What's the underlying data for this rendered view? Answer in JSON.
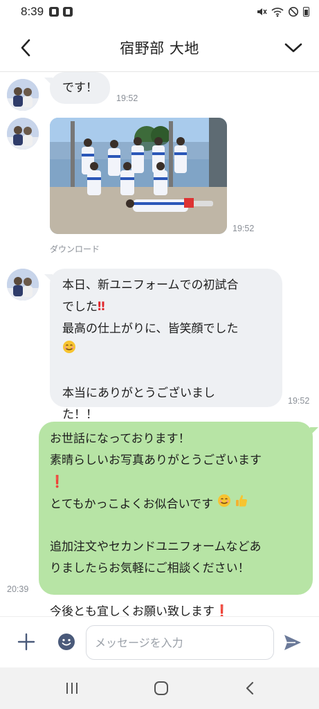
{
  "status_bar": {
    "time": "8:39",
    "left_icons": [
      "line-notification-icon",
      "app-notification-icon"
    ],
    "right_icons": [
      "mute-icon",
      "wifi-icon",
      "dnd-icon",
      "battery-icon"
    ]
  },
  "header": {
    "title": "宿野部 大地",
    "back_icon": "chevron-left-icon",
    "menu_icon": "chevron-down-icon"
  },
  "messages": [
    {
      "direction": "in",
      "type": "text",
      "lines": [
        "です！"
      ],
      "time": "19:52"
    },
    {
      "direction": "in",
      "type": "image",
      "time": "19:52",
      "download_label": "ダウンロード"
    },
    {
      "direction": "in",
      "type": "text",
      "lines": [
        "本日、新ユニフォームでの初試合",
        "でした",
        "最高の仕上がりに、皆笑顔でした",
        "",
        "",
        "本当にありがとうございまし",
        "た！！"
      ],
      "time": "19:52"
    },
    {
      "direction": "out",
      "type": "text",
      "lines": [
        "お世話になっております！",
        "素晴らしいお写真ありがとうございます",
        "",
        "とてもかっこよくお似合いです",
        "",
        "追加注文やセカンドユニフォームなどあ",
        "りましたらお気軽にご相談ください！",
        "",
        "今後とも宜しくお願い致します"
      ],
      "time": "20:39"
    }
  ],
  "input_bar": {
    "placeholder": "メッセージを入力",
    "value": ""
  },
  "colors": {
    "incoming_bubble": "#eef0f3",
    "outgoing_bubble": "#b7e4a5",
    "timestamp": "#8a8f97",
    "accent": "#4a5a7a"
  }
}
